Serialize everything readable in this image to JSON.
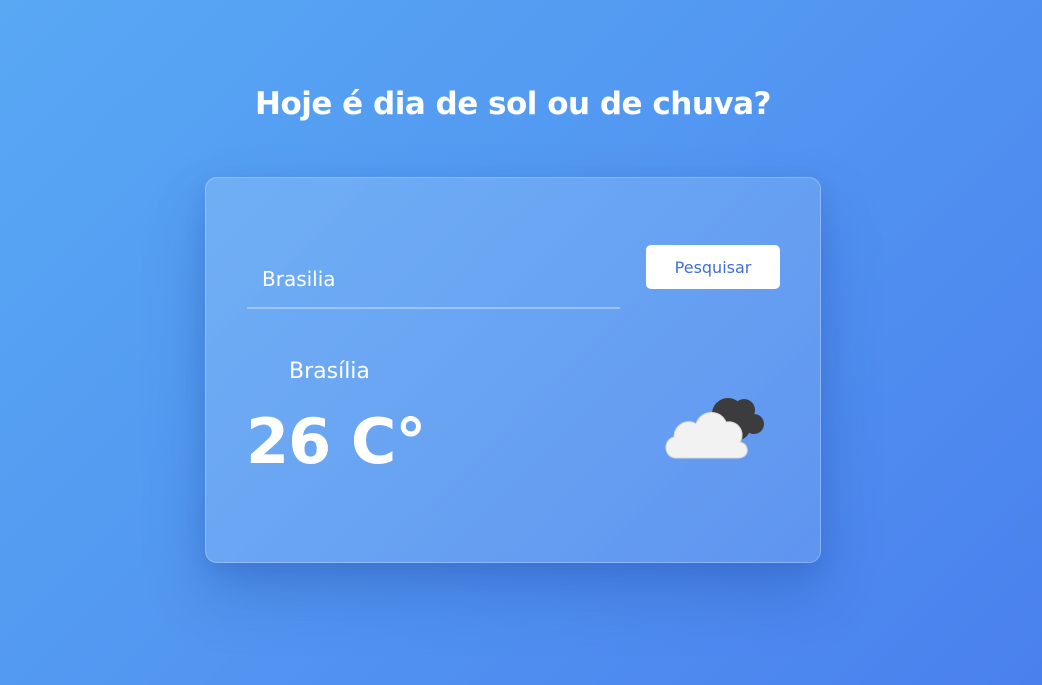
{
  "page": {
    "title": "Hoje é dia de sol ou de chuva?"
  },
  "search": {
    "value": "Brasilia",
    "button_label": "Pesquisar"
  },
  "weather": {
    "city": "Brasília",
    "temperature": "26 C°",
    "icon": "cloudy-icon"
  },
  "colors": {
    "background_start": "#58a8f4",
    "background_end": "#4a80ee",
    "button_text": "#3f6fd8",
    "button_bg": "#ffffff"
  }
}
